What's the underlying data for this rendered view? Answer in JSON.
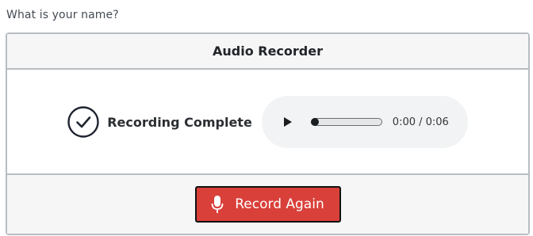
{
  "question": {
    "text": "What is your name?"
  },
  "recorder": {
    "title": "Audio Recorder",
    "status": "Recording Complete",
    "player": {
      "current_time": "0:00",
      "duration": "0:06",
      "time_display": "0:00 / 0:06",
      "progress": 0
    },
    "record_again_label": "Record Again"
  },
  "icons": {
    "status": "check-circle-icon",
    "play": "play-icon",
    "record": "microphone-icon"
  },
  "colors": {
    "record_button": "#d9403a",
    "player_bg": "#f1f3f4",
    "header_bg": "#f6f6f7"
  }
}
